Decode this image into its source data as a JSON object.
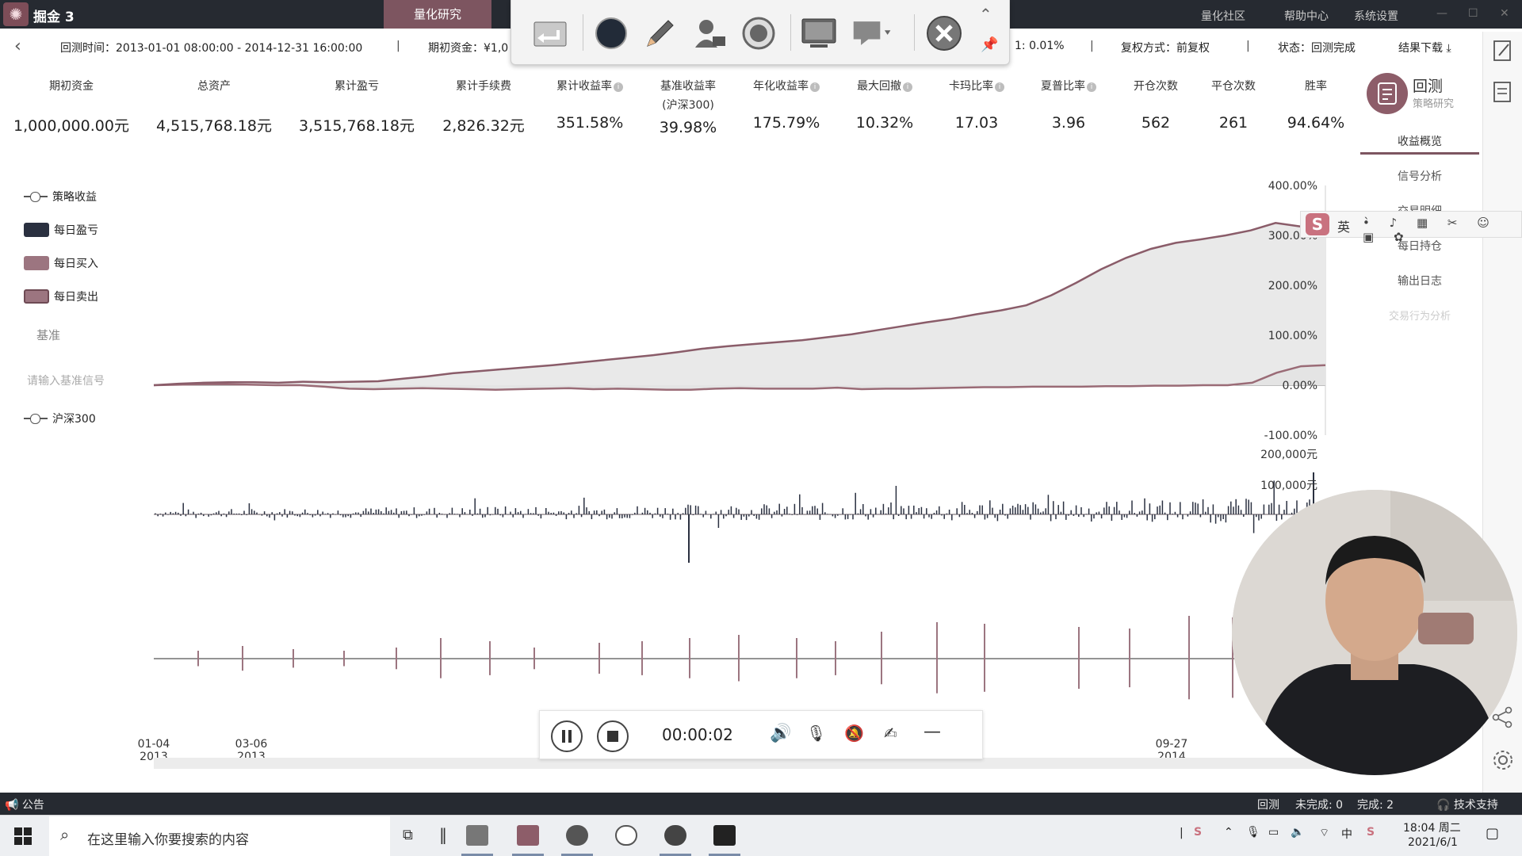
{
  "window": {
    "app_name": "掘金 3",
    "active_tab": "量化研究",
    "nav_community": "量化社区",
    "nav_help": "帮助中心",
    "nav_settings": "系统设置"
  },
  "info_bar": {
    "period": "回测时间：2013-01-01 08:00:00 - 2014-12-31 16:00:00",
    "initial_capital": "期初资金：¥1,0",
    "fee_rate": "1: 0.01%",
    "adjust_mode": "复权方式：前复权",
    "status": "状态：回测完成",
    "download": "结果下载"
  },
  "stats": [
    {
      "label": "期初资金",
      "value": "1,000,000.00元",
      "info": false
    },
    {
      "label": "总资产",
      "value": "4,515,768.18元",
      "info": false
    },
    {
      "label": "累计盈亏",
      "value": "3,515,768.18元",
      "info": false
    },
    {
      "label": "累计手续费",
      "value": "2,826.32元",
      "info": false
    },
    {
      "label": "累计收益率",
      "value": "351.58%",
      "info": true
    },
    {
      "label": "基准收益率",
      "sublabel": "(沪深300)",
      "value": "39.98%",
      "info": false
    },
    {
      "label": "年化收益率",
      "value": "175.79%",
      "info": true
    },
    {
      "label": "最大回撤",
      "value": "10.32%",
      "info": true
    },
    {
      "label": "卡玛比率",
      "value": "17.03",
      "info": true
    },
    {
      "label": "夏普比率",
      "value": "3.96",
      "info": true
    },
    {
      "label": "开仓次数",
      "value": "562",
      "info": false
    },
    {
      "label": "平仓次数",
      "value": "261",
      "info": false
    },
    {
      "label": "胜率",
      "value": "94.64%",
      "info": false
    }
  ],
  "right_panel": {
    "title": "回测",
    "subtitle": "策略研究",
    "menu": [
      "收益概览",
      "信号分析",
      "交易明细",
      "每日持仓",
      "输出日志",
      "交易行为分析"
    ]
  },
  "legend": {
    "strategy": "策略收益",
    "daily_pnl": "每日盈亏",
    "daily_buy": "每日买入",
    "daily_sell": "每日卖出",
    "benchmark_heading": "基准",
    "benchmark_placeholder": "请输入基准信号",
    "benchmark_series": "沪深300"
  },
  "chart_data": {
    "type": "area",
    "y_ticks": [
      "400.00%",
      "300.00%",
      "200.00%",
      "100.00%",
      "0.00%",
      "-100.00%"
    ],
    "ylim": [
      -100,
      400
    ],
    "pnl_ticks": [
      "200,000元",
      "100,000元"
    ],
    "x_labels": [
      {
        "date": "01-04",
        "year": "2013"
      },
      {
        "date": "03-06",
        "year": "2013"
      },
      {
        "date": "09-27",
        "year": "2014"
      }
    ],
    "series": [
      {
        "name": "策略收益",
        "color": "#8a5c69",
        "values": [
          0,
          3,
          5,
          6,
          6,
          5,
          7,
          6,
          7,
          8,
          13,
          18,
          24,
          28,
          32,
          36,
          40,
          45,
          50,
          55,
          60,
          66,
          73,
          78,
          82,
          86,
          90,
          96,
          102,
          110,
          118,
          126,
          133,
          142,
          150,
          160,
          180,
          205,
          232,
          255,
          273,
          285,
          292,
          300,
          310,
          325,
          318,
          322
        ]
      },
      {
        "name": "沪深300",
        "color": "#9a6b76",
        "values": [
          0,
          1,
          2,
          2,
          1,
          0,
          0,
          -3,
          -7,
          -8,
          -7,
          -6,
          -7,
          -8,
          -9,
          -8,
          -7,
          -6,
          -8,
          -7,
          -8,
          -9,
          -9,
          -7,
          -6,
          -7,
          -7,
          -7,
          -5,
          -8,
          -7,
          -7,
          -6,
          -5,
          -4,
          -4,
          -3,
          -3,
          -3,
          -2,
          -2,
          -1,
          -1,
          0,
          0,
          5,
          25,
          38,
          40
        ]
      }
    ]
  },
  "player": {
    "time": "00:00:02"
  },
  "status_bar": {
    "notice": "公告",
    "mode": "回测",
    "pending": "未完成: 0",
    "done": "完成: 2",
    "support": "技术支持"
  },
  "taskbar": {
    "search_placeholder": "在这里输入你要搜索的内容",
    "time": "18:04 周二",
    "date": "2021/6/1",
    "ime": "英"
  },
  "colors": {
    "brand": "#7d5560",
    "titlebar": "#262a31",
    "strategy_line": "#8a5c69",
    "area_fill": "#e9e9e9",
    "pnl_bar": "#2a3040",
    "buy_bar": "#9c7580"
  }
}
